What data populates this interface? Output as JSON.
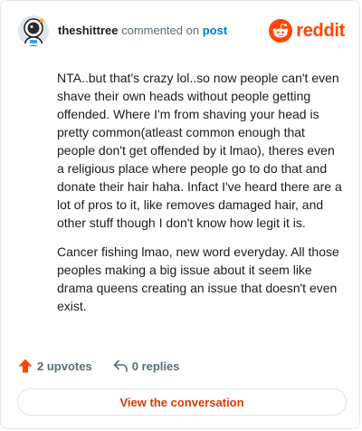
{
  "header": {
    "username": "theshittree",
    "action_text": "commented on",
    "post_link": "post",
    "brand": "reddit"
  },
  "comment": {
    "paragraphs": [
      "NTA..but that's crazy lol..so now people can't even shave their own heads without people getting offended. Where I'm from shaving your head is pretty common(atleast common enough that people don't get offended by it lmao), theres even a religious place where people go to do that and donate their hair haha. Infact I've heard there are a lot of pros to it, like removes damaged hair, and other stuff though I don't know how legit it is.",
      "Cancer fishing lmao, new word everyday. All those peoples making a big issue about it seem like drama queens creating an issue that doesn't even exist."
    ]
  },
  "actions": {
    "upvotes": "2 upvotes",
    "replies": "0 replies"
  },
  "view_button": "View the conversation",
  "colors": {
    "brand": "#ff4500",
    "link": "#0079d3",
    "muted": "#576f76",
    "button_text": "#d93a00"
  }
}
